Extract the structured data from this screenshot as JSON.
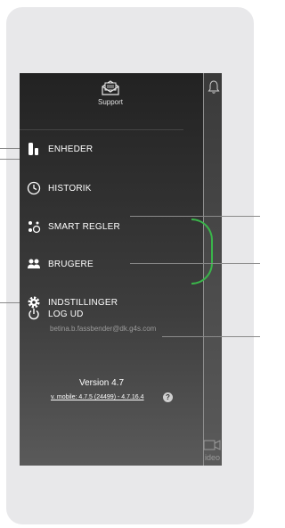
{
  "support": {
    "label": "Support"
  },
  "menu": [
    {
      "label": "ENHEDER",
      "icon": "devices-icon"
    },
    {
      "label": "HISTORIK",
      "icon": "clock-icon"
    },
    {
      "label": "SMART REGLER",
      "icon": "smart-rules-icon"
    },
    {
      "label": "BRUGERE",
      "icon": "users-icon"
    },
    {
      "label": "INDSTILLINGER",
      "icon": "gear-icon"
    },
    {
      "label": "LOG UD",
      "icon": "power-icon"
    }
  ],
  "account": {
    "email": "betina.b.fassbender@dk.g4s.com"
  },
  "version": {
    "label": "Version 4.7",
    "mobile": "v. mobile: 4.7.5 (24499) - 4.7.16.4"
  },
  "background": {
    "video_label": "ideo"
  },
  "colors": {
    "accent_ring": "#3ab54a"
  }
}
